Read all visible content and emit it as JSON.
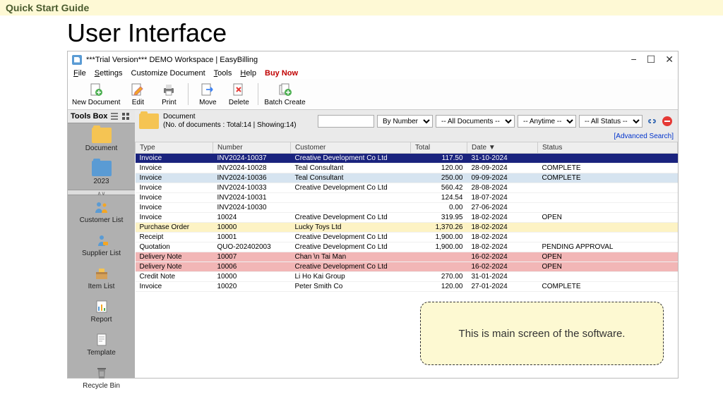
{
  "banner": "Quick Start Guide",
  "heading": "User Interface",
  "window": {
    "title": "***Trial Version*** DEMO Workspace | EasyBilling",
    "menu": {
      "file": "File",
      "settings": "Settings",
      "customize": "Customize Document",
      "tools": "Tools",
      "help": "Help",
      "buy": "Buy Now"
    }
  },
  "toolbar": {
    "new": "New Document",
    "edit": "Edit",
    "print": "Print",
    "move": "Move",
    "delete": "Delete",
    "batch": "Batch Create"
  },
  "sidebar": {
    "title": "Tools Box",
    "upper": [
      {
        "label": "Document",
        "cls": "folder-ico"
      },
      {
        "label": "2023",
        "cls": "folder-ico folder-blue"
      }
    ],
    "lower": [
      "Customer List",
      "Supplier List",
      "Item List",
      "Report",
      "Template",
      "Recycle Bin"
    ]
  },
  "docpanel": {
    "title": "Document",
    "sub": "(No. of documents : Total:14 | Showing:14)"
  },
  "filters": {
    "search_placeholder": "",
    "by": "By Number",
    "docs": "-- All Documents --",
    "time": "-- Anytime --",
    "status": "-- All Status --"
  },
  "adv": "[Advanced Search]",
  "cols": {
    "type": "Type",
    "number": "Number",
    "customer": "Customer",
    "total": "Total",
    "date": "Date ▼",
    "status": "Status"
  },
  "rows": [
    {
      "type": "Invoice",
      "num": "INV2024-10037",
      "cust": "Creative Development Co Ltd",
      "total": "117.50",
      "date": "31-10-2024",
      "status": "",
      "cls": "sel"
    },
    {
      "type": "Invoice",
      "num": "INV2024-10028",
      "cust": "Teal Consultant",
      "total": "120.00",
      "date": "28-09-2024",
      "status": "COMPLETE",
      "cls": ""
    },
    {
      "type": "Invoice",
      "num": "INV2024-10036",
      "cust": "Teal Consultant",
      "total": "250.00",
      "date": "09-09-2024",
      "status": "COMPLETE",
      "cls": "alt"
    },
    {
      "type": "Invoice",
      "num": "INV2024-10033",
      "cust": "Creative Development Co Ltd",
      "total": "560.42",
      "date": "28-08-2024",
      "status": "",
      "cls": ""
    },
    {
      "type": "Invoice",
      "num": "INV2024-10031",
      "cust": "",
      "total": "124.54",
      "date": "18-07-2024",
      "status": "",
      "cls": ""
    },
    {
      "type": "Invoice",
      "num": "INV2024-10030",
      "cust": "",
      "total": "0.00",
      "date": "27-06-2024",
      "status": "",
      "cls": ""
    },
    {
      "type": "Invoice",
      "num": "10024",
      "cust": "Creative Development Co Ltd",
      "total": "319.95",
      "date": "18-02-2024",
      "status": "OPEN",
      "cls": ""
    },
    {
      "type": "Purchase Order",
      "num": "10000",
      "cust": "Lucky Toys Ltd",
      "total": "1,370.26",
      "date": "18-02-2024",
      "status": "",
      "cls": "yel"
    },
    {
      "type": "Receipt",
      "num": "10001",
      "cust": "Creative Development Co Ltd",
      "total": "1,900.00",
      "date": "18-02-2024",
      "status": "",
      "cls": ""
    },
    {
      "type": "Quotation",
      "num": "QUO-202402003",
      "cust": "Creative Development Co Ltd",
      "total": "1,900.00",
      "date": "18-02-2024",
      "status": "PENDING APPROVAL",
      "cls": ""
    },
    {
      "type": "Delivery Note",
      "num": "10007",
      "cust": "Chan \\n Tai Man",
      "total": "",
      "date": "16-02-2024",
      "status": "OPEN",
      "cls": "pnk"
    },
    {
      "type": "Delivery Note",
      "num": "10006",
      "cust": "Creative Development Co Ltd",
      "total": "",
      "date": "16-02-2024",
      "status": "OPEN",
      "cls": "pnk"
    },
    {
      "type": "Credit Note",
      "num": "10000",
      "cust": "Li Ho Kai Group",
      "total": "270.00",
      "date": "31-01-2024",
      "status": "",
      "cls": ""
    },
    {
      "type": "Invoice",
      "num": "10020",
      "cust": "Peter Smith Co",
      "total": "120.00",
      "date": "27-01-2024",
      "status": "COMPLETE",
      "cls": ""
    }
  ],
  "callout": "This is main screen of the software."
}
